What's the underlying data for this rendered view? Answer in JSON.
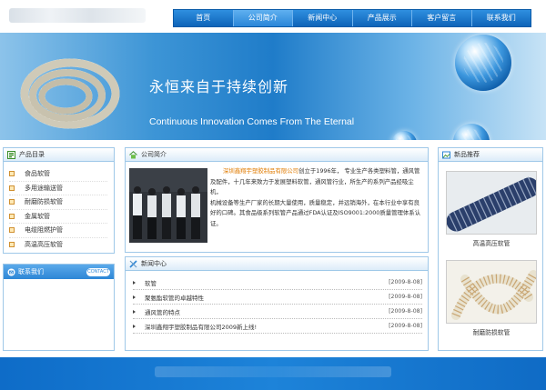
{
  "nav": {
    "items": [
      "首页",
      "公司简介",
      "新闻中心",
      "产品展示",
      "客户留言",
      "联系我们"
    ],
    "active_index": 1
  },
  "banner": {
    "title_cn": "永恒来自于持续创新",
    "title_en": "Continuous Innovation Comes From The Eternal"
  },
  "products": {
    "title": "产品目录",
    "items": [
      "食品软管",
      "多用途输送管",
      "耐磨防损软管",
      "金属软管",
      "电缆阻燃护管",
      "高温高压软管"
    ]
  },
  "contact": {
    "title": "联系我们",
    "badge": "CONTACT"
  },
  "about": {
    "title": "公司简介",
    "company": "深圳鑫翔宇塑胶制品有限公司",
    "text_after_company": "创立于1996年，  专业生产各类塑料管，通风管及配件，十几年来致力于发展塑料软管，通风管行业，所生产的系列产品经吸尘机，",
    "paragraph2": "机械设备等生产厂家的长期大量使用，质量稳定，并远销海外，在本行业中享有良好的口碑。其食品级系列软管产品通过FDA认证及ISO9001:2000质量管理体系认证。"
  },
  "news": {
    "title": "新闻中心",
    "items": [
      {
        "title": "软管",
        "date": "[2009-8-08]"
      },
      {
        "title": "聚氨酯软管的卓越特性",
        "date": "[2009-8-08]"
      },
      {
        "title": "通风管的特点",
        "date": "[2009-8-08]"
      },
      {
        "title": "深圳鑫翔宇塑胶制品有限公司2009新上线!",
        "date": "[2009-8-08]"
      }
    ]
  },
  "recommended": {
    "title": "新品推荐",
    "items": [
      {
        "caption": "高温高压软管"
      },
      {
        "caption": "耐磨防损软管"
      }
    ]
  }
}
